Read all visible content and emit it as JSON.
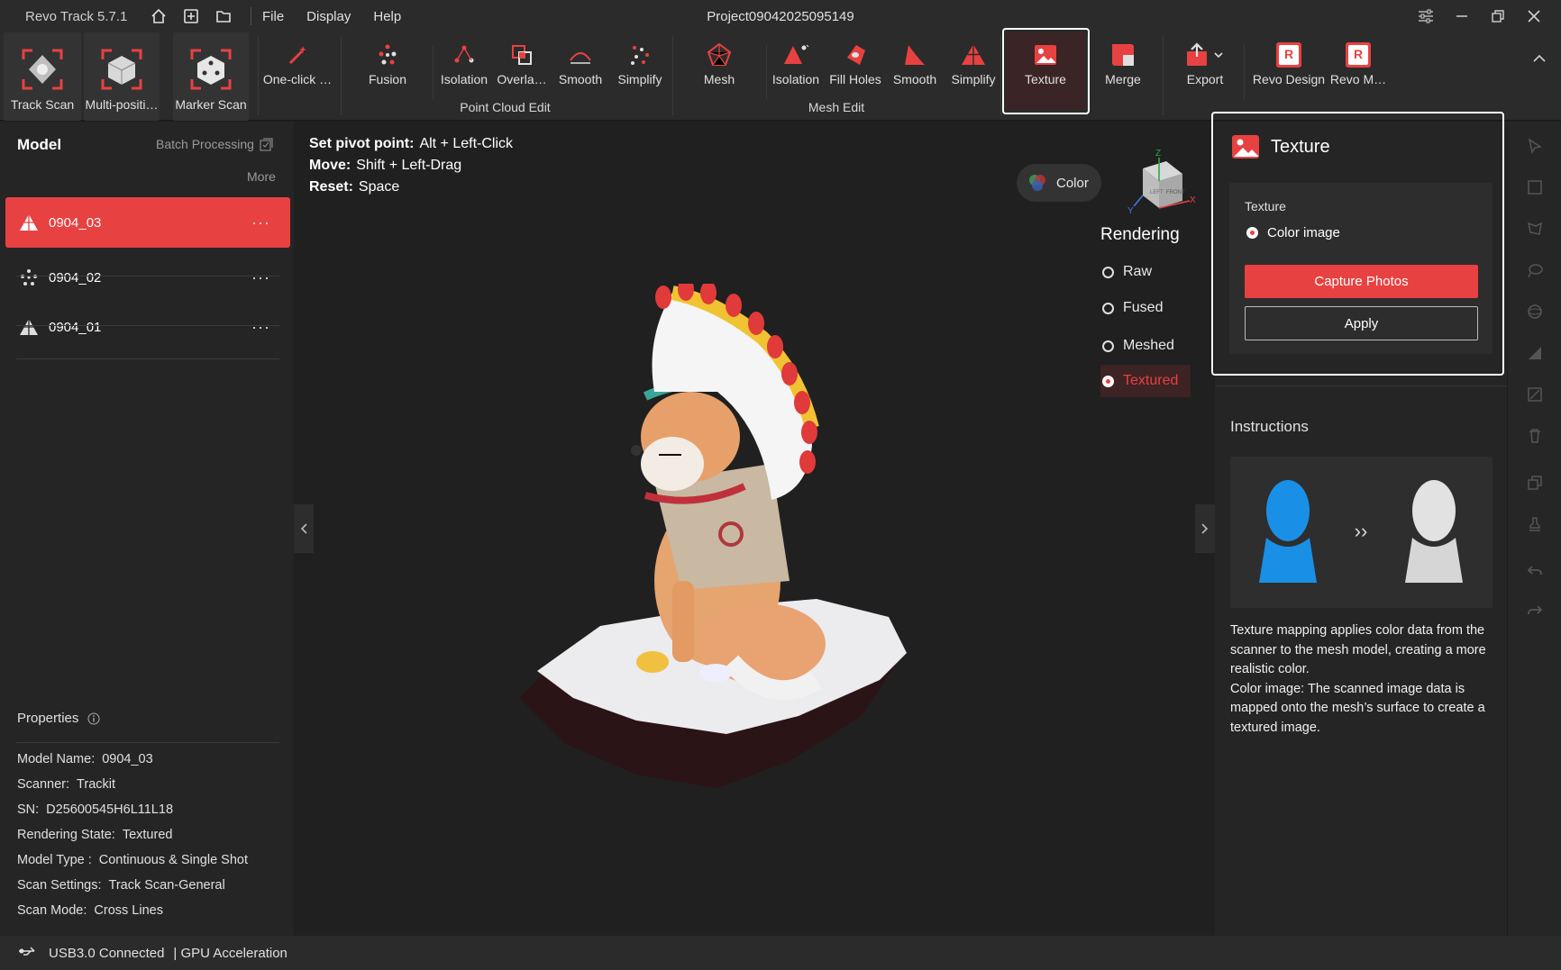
{
  "app": {
    "name": "Revo Track 5.7.1",
    "project_title": "Project09042025095149",
    "menu": [
      "File",
      "Display",
      "Help"
    ]
  },
  "ribbon": {
    "scan": [
      "Track Scan",
      "Multi-positi…",
      "Marker Scan"
    ],
    "one_click": "One-click …",
    "fusion": "Fusion",
    "point_cloud": [
      "Isolation",
      "Overla…",
      "Smooth",
      "Simplify"
    ],
    "point_cloud_group": "Point Cloud Edit",
    "mesh": "Mesh",
    "mesh_edit": [
      "Isolation",
      "Fill Holes",
      "Smooth",
      "Simplify"
    ],
    "mesh_edit_group": "Mesh Edit",
    "texture": "Texture",
    "merge": "Merge",
    "export": "Export",
    "revo_design": "Revo Design",
    "revo_measure": "Revo M…"
  },
  "left": {
    "title": "Model",
    "batch": "Batch Processing",
    "more": "More",
    "models": [
      {
        "name": "0904_03",
        "icon": "mesh-icon",
        "active": true
      },
      {
        "name": "0904_02",
        "icon": "point-cloud-icon",
        "active": false
      },
      {
        "name": "0904_01",
        "icon": "mesh-icon",
        "active": false
      }
    ],
    "properties_title": "Properties",
    "properties": [
      {
        "k": "Model Name:",
        "v": "0904_03"
      },
      {
        "k": "Scanner:",
        "v": "Trackit"
      },
      {
        "k": "SN:",
        "v": "D25600545H6L11L18"
      },
      {
        "k": "Rendering State:",
        "v": "Textured"
      },
      {
        "k": "Model Type :",
        "v": "Continuous & Single Shot"
      },
      {
        "k": "Scan Settings:",
        "v": "Track Scan-General"
      },
      {
        "k": "Scan Mode:",
        "v": "Cross Lines"
      }
    ]
  },
  "viewport": {
    "hints": [
      {
        "k": "Set pivot point:",
        "v": "Alt + Left-Click"
      },
      {
        "k": "Move:",
        "v": "Shift + Left-Drag"
      },
      {
        "k": "Reset:",
        "v": "Space"
      }
    ],
    "color_btn": "Color",
    "cube": {
      "z": "Z",
      "x": "X",
      "y": "Y",
      "left": "LEFT",
      "front": "FRONT"
    },
    "rendering_title": "Rendering",
    "rendering": [
      {
        "label": "Raw",
        "active": false
      },
      {
        "label": "Fused",
        "active": false
      },
      {
        "label": "Meshed",
        "active": false
      },
      {
        "label": "Textured",
        "active": true
      }
    ]
  },
  "right": {
    "title": "Texture",
    "texture_label": "Texture",
    "option": "Color image",
    "capture": "Capture Photos",
    "apply": "Apply",
    "instructions_title": "Instructions",
    "instructions_arrow": "››",
    "instructions_1": "Texture mapping applies color data from the scanner to the mesh model, creating a more realistic color.",
    "instructions_2": "Color image: The scanned image data is mapped onto the mesh’s surface to create a textured image."
  },
  "status": {
    "usb": "USB3.0 Connected",
    "gpu": "| GPU Acceleration"
  },
  "colors": {
    "accent": "#e84141",
    "bg": "#1e1e1e"
  }
}
